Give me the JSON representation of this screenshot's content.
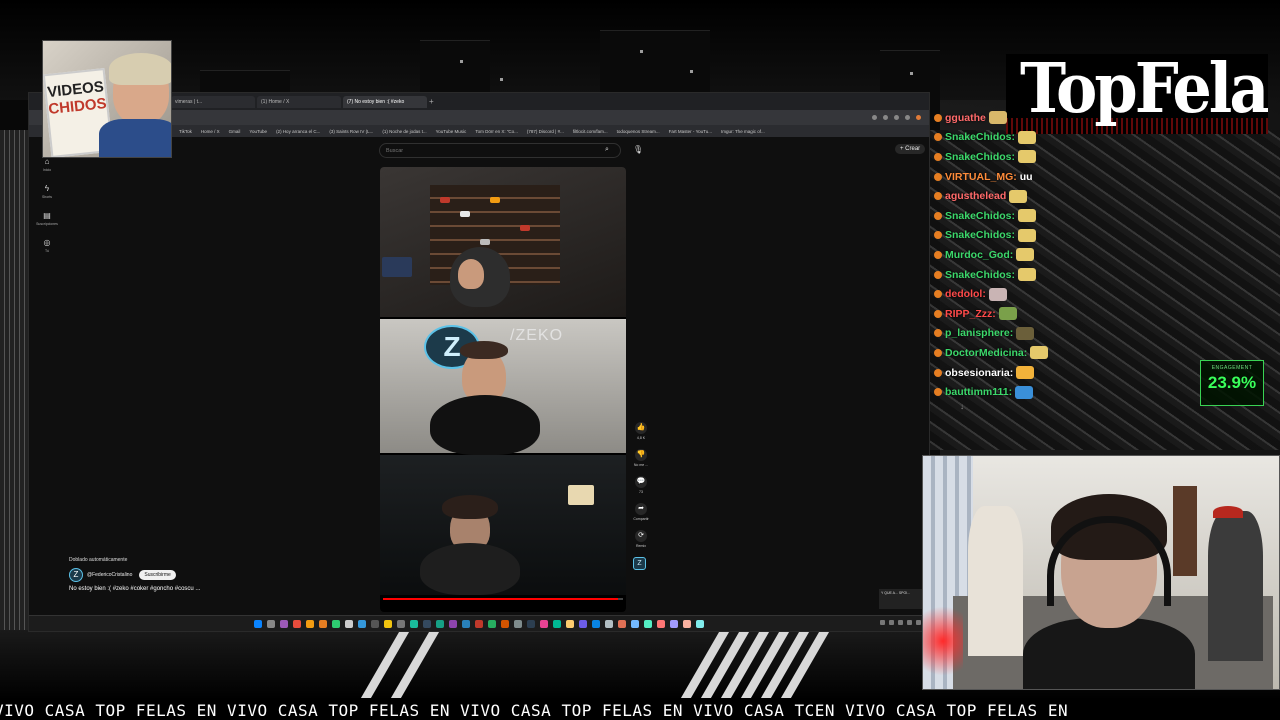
{
  "brand": {
    "name": "TopFelas"
  },
  "overlay_webcam": {
    "sign_line1": "VIDEOS",
    "sign_line2": "CHIDOS"
  },
  "browser": {
    "tabs": [
      {
        "title": "vimeras | t...",
        "active": false
      },
      {
        "title": "(1) Home / X",
        "active": false
      },
      {
        "title": "(7) No estoy bien :( #zeko",
        "active": true
      }
    ],
    "new_tab": "+",
    "bookmarks": [
      "TikTok",
      "Home / X",
      "Gmail",
      "YouTube",
      "(2) Hoy arranca el C...",
      "(3) Saints Row IV (L...",
      "(1) Noche de jodas t...",
      "YouTube Music",
      "Tom Dörr en X: \"Co...",
      "(787) Discord | #...",
      "filtlocit.com/fam...",
      "todoquenos Stream...",
      "Fart Master - YouTu...",
      "Imgur: The magic of..."
    ]
  },
  "youtube": {
    "search_placeholder": "Buscar",
    "create_label": "Crear",
    "nav": [
      {
        "icon": "home-icon",
        "glyph": "⌂",
        "label": "Inicio"
      },
      {
        "icon": "shorts-icon",
        "glyph": "ϟ",
        "label": "Shorts"
      },
      {
        "icon": "subscriptions-icon",
        "glyph": "▤",
        "label": "Suscripciones"
      },
      {
        "icon": "you-icon",
        "glyph": "◎",
        "label": "Tú"
      }
    ],
    "short": {
      "zeko_text": "/ZEKO",
      "progress": 0.98,
      "actions": [
        {
          "icon": "like-icon",
          "glyph": "👍",
          "label": "4,8 K"
        },
        {
          "icon": "dislike-icon",
          "glyph": "👎",
          "label": "No me ..."
        },
        {
          "icon": "comment-icon",
          "glyph": "💬",
          "label": "73"
        },
        {
          "icon": "share-icon",
          "glyph": "➦",
          "label": "Compartir"
        },
        {
          "icon": "remix-icon",
          "glyph": "⟳",
          "label": "Remix"
        }
      ]
    },
    "meta": {
      "dubbed": "Doblado automáticamente",
      "channel": "@FedericoCristalino",
      "subscribe": "Suscribirme",
      "title": "No estoy bien :( #zeko #coker #goncho #coscu ..."
    },
    "mini_thumb": "Y QUE A... SPOI..."
  },
  "chat": [
    {
      "user": "gguathe",
      "color": "#ff6a6a",
      "message": "",
      "emote": "#d9b86a"
    },
    {
      "user": "SnakeChidos:",
      "color": "#3cd86b",
      "message": "",
      "emote": "#e5c96b"
    },
    {
      "user": "SnakeChidos:",
      "color": "#3cd86b",
      "message": "",
      "emote": "#e5c96b"
    },
    {
      "user": "VIRTUAL_MG:",
      "color": "#ff8c3a",
      "message": "uu",
      "emote": ""
    },
    {
      "user": "agusthelead",
      "color": "#ff6a6a",
      "message": "",
      "emote": "#e5c96b"
    },
    {
      "user": "SnakeChidos:",
      "color": "#3cd86b",
      "message": "",
      "emote": "#e5c96b"
    },
    {
      "user": "SnakeChidos:",
      "color": "#3cd86b",
      "message": "",
      "emote": "#e5c96b"
    },
    {
      "user": "Murdoc_God:",
      "color": "#3cd86b",
      "message": "",
      "emote": "#e5c96b"
    },
    {
      "user": "SnakeChidos:",
      "color": "#3cd86b",
      "message": "",
      "emote": "#e5c96b"
    },
    {
      "user": "dedolol:",
      "color": "#ff4a4a",
      "message": "",
      "emote": "#c9b4b4"
    },
    {
      "user": "RIPP_Zzz:",
      "color": "#ff4a4a",
      "message": "",
      "emote": "#7aa04a"
    },
    {
      "user": "p_lanisphere:",
      "color": "#3cd86b",
      "message": "",
      "emote": "#6b5f3a"
    },
    {
      "user": "DoctorMedicina:",
      "color": "#3cd86b",
      "message": "",
      "emote": "#e5c96b"
    },
    {
      "user": "obsesionaria:",
      "color": "#ffffff",
      "message": "",
      "emote": "#f2b23a"
    },
    {
      "user": "bauttimm111:",
      "color": "#3cd86b",
      "message": "",
      "emote": "#3a8fd8"
    }
  ],
  "chat_scroll": "↓",
  "engagement": {
    "label": "ENGAGEMENT",
    "value": "23.9%"
  },
  "ticker": "VIVO CASA TOP FELAS EN VIVO CASA TOP FELAS EN VIVO CASA TOP FELAS EN VIVO CASA TCEN VIVO CASA TOP FELAS EN"
}
